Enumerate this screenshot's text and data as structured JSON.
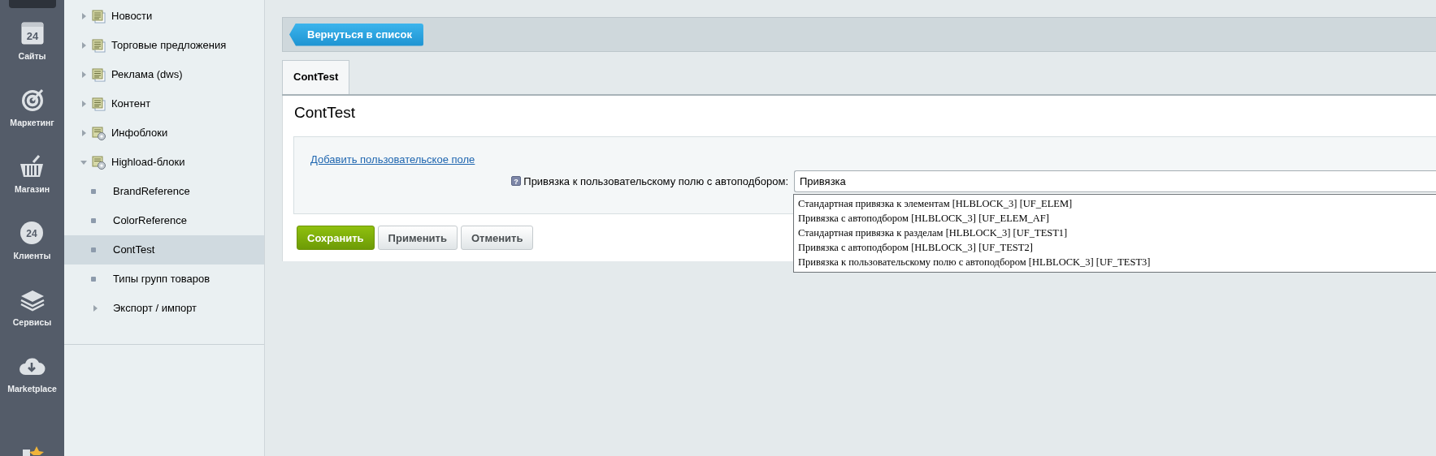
{
  "main_menu": [
    {
      "label": "Сайты",
      "icon_text": "24"
    },
    {
      "label": "Маркетинг"
    },
    {
      "label": "Магазин"
    },
    {
      "label": "Клиенты",
      "icon_text": "24"
    },
    {
      "label": "Сервисы"
    },
    {
      "label": "Marketplace"
    }
  ],
  "tree": [
    {
      "label": "Новости",
      "kind": "list",
      "expanded": false,
      "selected": false
    },
    {
      "label": "Торговые предложения",
      "kind": "list",
      "expanded": false,
      "selected": false
    },
    {
      "label": "Реклама (dws)",
      "kind": "list",
      "expanded": false,
      "selected": false
    },
    {
      "label": "Контент",
      "kind": "list",
      "expanded": false,
      "selected": false
    },
    {
      "label": "Инфоблоки",
      "kind": "settings",
      "expanded": false,
      "selected": false
    },
    {
      "label": "Highload-блоки",
      "kind": "settings",
      "expanded": true,
      "selected": false,
      "children": [
        {
          "label": "BrandReference",
          "kind": "leaf",
          "selected": false
        },
        {
          "label": "ColorReference",
          "kind": "leaf",
          "selected": false
        },
        {
          "label": "ContTest",
          "kind": "leaf",
          "selected": true
        },
        {
          "label": "Типы групп товаров",
          "kind": "leaf",
          "selected": false
        },
        {
          "label": "Экспорт / импорт",
          "kind": "branch",
          "expanded": false,
          "selected": false
        }
      ]
    }
  ],
  "back_button": "Вернуться в список",
  "tabs": [
    {
      "label": "ContTest",
      "selected": true
    }
  ],
  "page_title": "ContTest",
  "add_field_link": "Добавить пользовательское поле",
  "field": {
    "help_mark": "?",
    "label": "Привязка к пользовательскому полю с автоподбором:",
    "value": "Привязка",
    "suggestions": [
      "Стандартная привязка к элементам [HLBLOCK_3] [UF_ELEM]",
      "Привязка с автоподбором [HLBLOCK_3] [UF_ELEM_AF]",
      "Стандартная привязка к разделам [HLBLOCK_3] [UF_TEST1]",
      "Привязка с автоподбором [HLBLOCK_3] [UF_TEST2]",
      "Привязка к пользовательскому полю с автоподбором [HLBLOCK_3] [UF_TEST3]"
    ]
  },
  "buttons": [
    {
      "label": "Сохранить",
      "kind": "primary"
    },
    {
      "label": "Применить",
      "kind": "default"
    },
    {
      "label": "Отменить",
      "kind": "default"
    }
  ]
}
